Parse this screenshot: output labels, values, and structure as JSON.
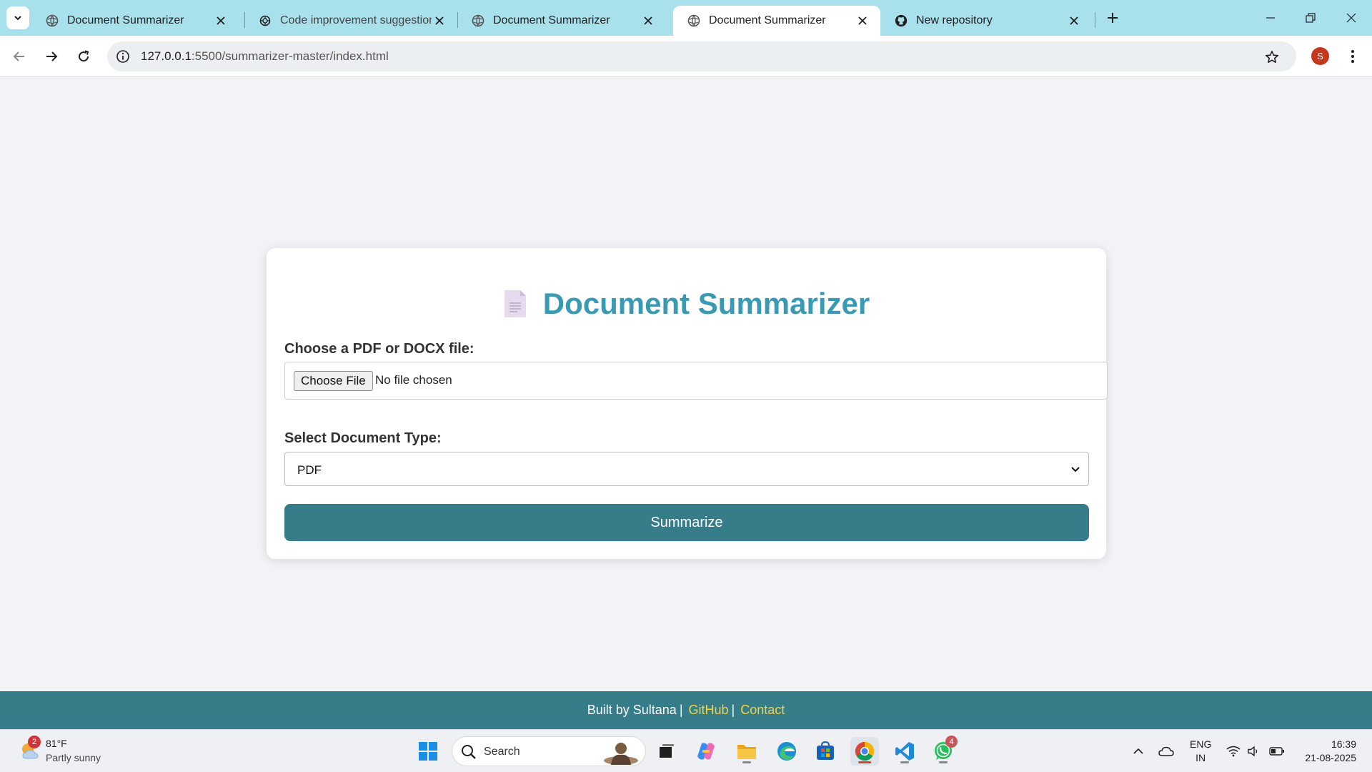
{
  "browser": {
    "tabs": [
      {
        "title": "Document Summarizer",
        "favicon": "globe-icon",
        "active": false
      },
      {
        "title": "Code improvement suggestions",
        "favicon": "openai-icon",
        "active": false
      },
      {
        "title": "Document Summarizer",
        "favicon": "globe-icon",
        "active": false
      },
      {
        "title": "Document Summarizer",
        "favicon": "globe-icon",
        "active": true
      },
      {
        "title": "New repository",
        "favicon": "github-icon",
        "active": false
      }
    ],
    "url_host": "127.0.0.1",
    "url_rest": ":5500/summarizer-master/index.html",
    "profile_initial": "S"
  },
  "page": {
    "title": "Document Summarizer",
    "file_label": "Choose a PDF or DOCX file:",
    "choose_file_button": "Choose File",
    "no_file_text": "No file chosen",
    "doc_type_label": "Select Document Type:",
    "doc_type_selected": "PDF",
    "summarize_button": "Summarize"
  },
  "footer": {
    "built_by": "Built by Sultana",
    "separator": "|",
    "github": "GitHub",
    "contact": "Contact"
  },
  "taskbar": {
    "weather_badge": "2",
    "temperature": "81°F",
    "condition": "Partly sunny",
    "search_placeholder": "Search",
    "whatsapp_badge": "4",
    "lang_line1": "ENG",
    "lang_line2": "IN",
    "time": "16:39",
    "date": "21-08-2025"
  },
  "colors": {
    "accent": "#367d89",
    "heading": "#3b9ab3",
    "footer_link": "#f8d23c",
    "tabstrip": "#a8e0ec"
  }
}
